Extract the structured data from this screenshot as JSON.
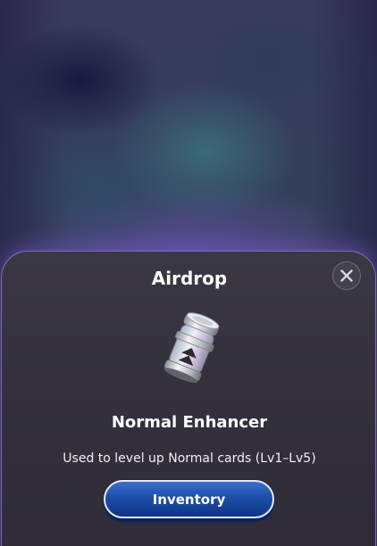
{
  "popup": {
    "title": "Airdrop",
    "close_icon": "close-icon",
    "item": {
      "icon": "enhancer-canister-icon",
      "name": "Normal Enhancer",
      "description": "Used to level up Normal cards (Lv1–Lv5)"
    },
    "inventory_button_label": "Inventory"
  },
  "colors": {
    "button_blue": "#1c4ea8",
    "sheet_border": "#9682e6",
    "sheet_bg": "#34313d"
  }
}
